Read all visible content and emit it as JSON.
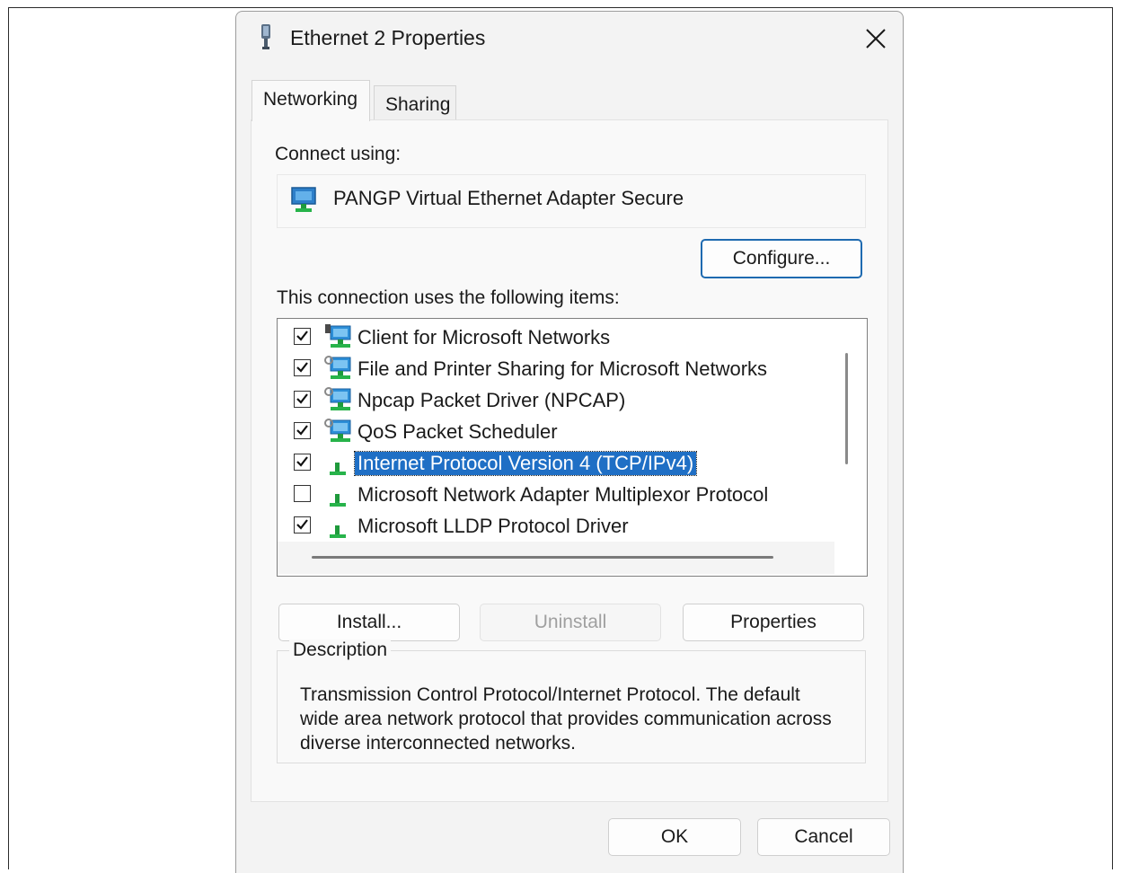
{
  "window": {
    "title": "Ethernet 2 Properties",
    "close_glyph": "✕"
  },
  "tabs": [
    {
      "label": "Networking",
      "active": true
    },
    {
      "label": "Sharing",
      "active": false
    }
  ],
  "connect_using": {
    "label": "Connect using:",
    "adapter_name": "PANGP Virtual Ethernet Adapter Secure",
    "configure_button": "Configure..."
  },
  "items_section": {
    "label": "This connection uses the following items:",
    "items": [
      {
        "label": "Client for Microsoft Networks",
        "checked": true,
        "icon": "network-client-icon",
        "selected": false
      },
      {
        "label": "File and Printer Sharing for Microsoft Networks",
        "checked": true,
        "icon": "network-service-icon",
        "selected": false
      },
      {
        "label": "Npcap Packet Driver (NPCAP)",
        "checked": true,
        "icon": "network-service-icon",
        "selected": false
      },
      {
        "label": "QoS Packet Scheduler",
        "checked": true,
        "icon": "network-service-icon",
        "selected": false
      },
      {
        "label": "Internet Protocol Version 4 (TCP/IPv4)",
        "checked": true,
        "icon": "protocol-icon",
        "selected": true
      },
      {
        "label": "Microsoft Network Adapter Multiplexor Protocol",
        "checked": false,
        "icon": "protocol-icon",
        "selected": false
      },
      {
        "label": "Microsoft LLDP Protocol Driver",
        "checked": true,
        "icon": "protocol-icon",
        "selected": false
      }
    ]
  },
  "actions": {
    "install": "Install...",
    "uninstall": "Uninstall",
    "properties": "Properties"
  },
  "description": {
    "legend": "Description",
    "text": "Transmission Control Protocol/Internet Protocol. The default wide area network protocol that provides communication across diverse interconnected networks."
  },
  "footer": {
    "ok": "OK",
    "cancel": "Cancel"
  },
  "colors": {
    "selection": "#1f6fc5",
    "focus_border": "#1e6ab0",
    "dialog_bg": "#f3f3f3"
  }
}
